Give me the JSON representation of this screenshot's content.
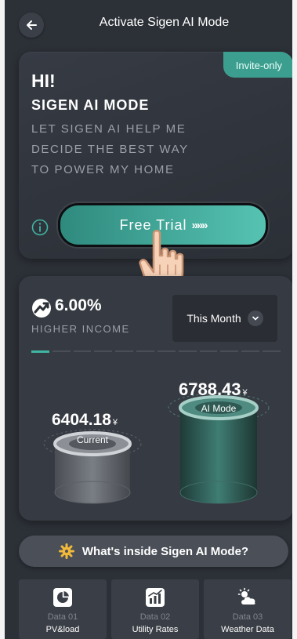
{
  "header": {
    "title": "Activate Sigen AI Mode",
    "back_icon": "arrow-left-icon"
  },
  "promo": {
    "badge": "Invite-only",
    "greeting": "HI!",
    "title": "SIGEN AI MODE",
    "description_lines": [
      "LET SIGEN AI HELP ME",
      "DECIDE THE BEST WAY",
      "TO POWER MY HOME"
    ],
    "cta_label": "Free Trial",
    "cta_arrows": "»»»",
    "accent_color": "#3fb5a2"
  },
  "income": {
    "percent": "6.00%",
    "label": "HIGHER INCOME",
    "period": "This Month",
    "current": {
      "value": "6404.18",
      "currency": "¥",
      "label": "Current"
    },
    "ai_mode": {
      "value": "6788.43",
      "currency": "¥",
      "label": "AI Mode"
    }
  },
  "inside": {
    "label": "What's inside Sigen AI Mode?",
    "icon": "gear-icon"
  },
  "data_tiles": [
    {
      "num": "Data 01",
      "name": "PV&load",
      "icon": "pie-chart-icon"
    },
    {
      "num": "Data 02",
      "name": "Utility Rates",
      "icon": "bar-chart-icon"
    },
    {
      "num": "Data 03",
      "name": "Weather Data",
      "icon": "weather-icon"
    }
  ]
}
